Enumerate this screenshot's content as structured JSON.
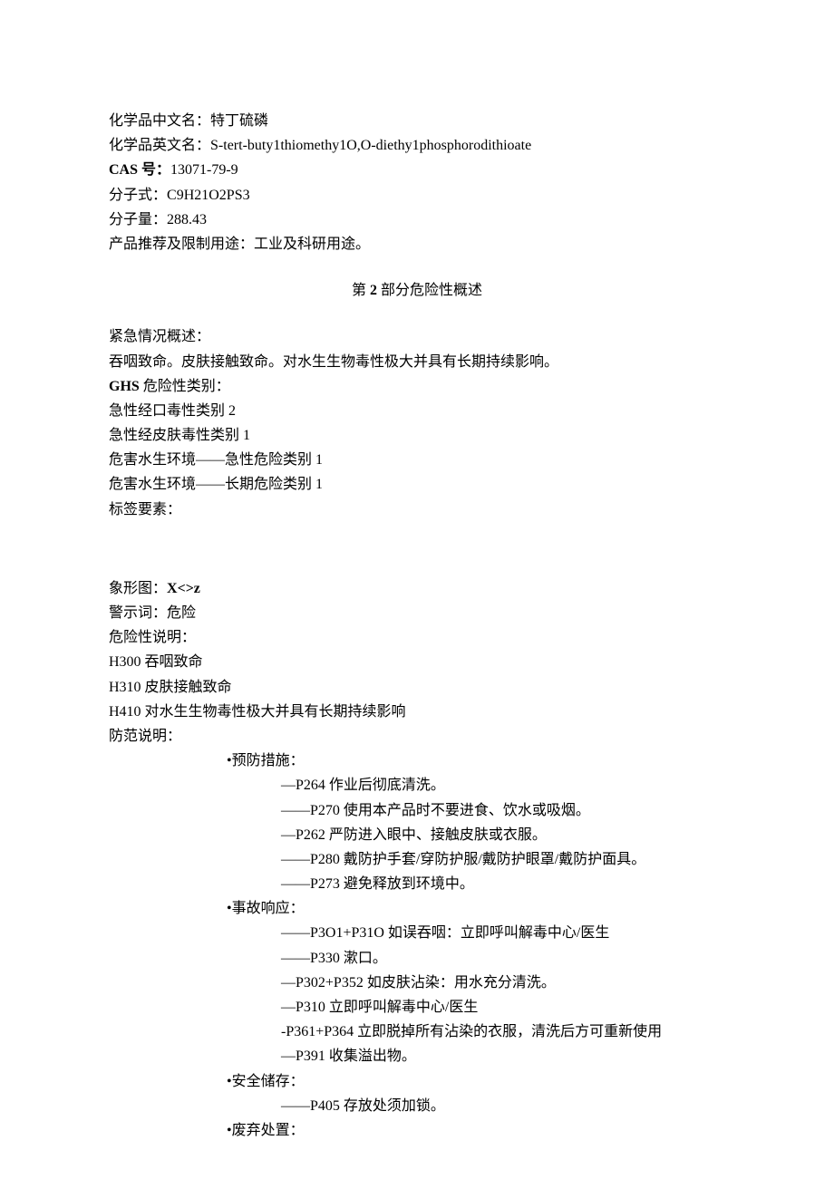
{
  "id": {
    "name_cn_label": "化学品中文名：",
    "name_cn_value": "特丁硫磷",
    "name_en_label": "化学品英文名：",
    "name_en_value": "S-tert-buty1thiomethy1O,O-diethy1phosphorodithioate",
    "cas_label": "CAS 号：",
    "cas_value": "13071-79-9",
    "formula_label": "分子式：",
    "formula_value": "C9H21O2PS3",
    "mw_label": "分子量：",
    "mw_value": "288.43",
    "use_label": "产品推荐及限制用途：",
    "use_value": "工业及科研用途。"
  },
  "section2_heading": {
    "prefix": "第 ",
    "num": "2",
    "suffix": " 部分危险性概述"
  },
  "hazard": {
    "emergency_label": "紧急情况概述：",
    "emergency_text": "吞咽致命。皮肤接触致命。对水生生物毒性极大并具有长期持续影响。",
    "ghs_label_bold": "GHS",
    "ghs_label_rest": " 危险性类别：",
    "ghs_cats": [
      "急性经口毒性类别 2",
      "急性经皮肤毒性类别 1",
      "危害水生环境——急性危险类别 1",
      "危害水生环境——长期危险类别 1"
    ],
    "label_elements": "标签要素：",
    "pictogram_label": "象形图：",
    "pictogram_value": "X<>z",
    "signal_label": "警示词：",
    "signal_value": "危险",
    "haz_stmt_label": "危险性说明：",
    "haz_stmts": [
      "H300 吞咽致命",
      "H310 皮肤接触致命",
      "H410 对水生生物毒性极大并具有长期持续影响"
    ],
    "precaution_label": "防范说明：",
    "precaution_groups": [
      {
        "title": "•预防措施：",
        "items": [
          "—P264 作业后彻底清洗。",
          "——P270 使用本产品时不要进食、饮水或吸烟。",
          "—P262 严防进入眼中、接触皮肤或衣服。",
          "——P280 戴防护手套/穿防护服/戴防护眼罩/戴防护面具。",
          "——P273 避免释放到环境中。"
        ]
      },
      {
        "title": "•事故响应：",
        "items": [
          "——P3O1+P31O 如误吞咽：立即呼叫解毒中心/医生",
          "——P330 漱口。",
          "—P302+P352 如皮肤沾染：用水充分清洗。",
          "—P310 立即呼叫解毒中心/医生",
          "-P361+P364 立即脱掉所有沾染的衣服，清洗后方可重新使用",
          "—P391 收集溢出物。"
        ]
      },
      {
        "title": "•安全储存：",
        "items": [
          "——P405 存放处须加锁。"
        ]
      },
      {
        "title": "•废弃处置：",
        "items": []
      }
    ]
  }
}
